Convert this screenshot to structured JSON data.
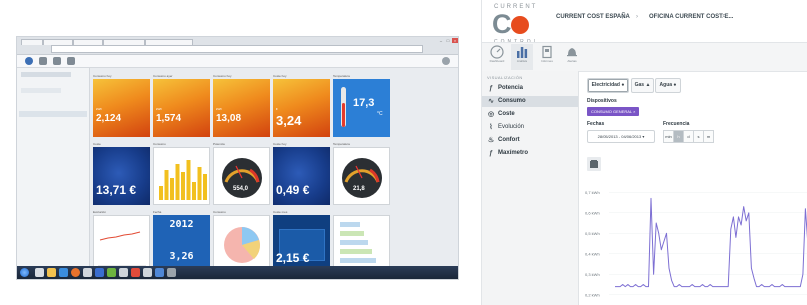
{
  "left_screenshot": {
    "browser_address": "",
    "tiles": [
      {
        "id": "t1",
        "title": "Consumo hoy",
        "value": "2,124",
        "sub": "kWh",
        "style": "orange"
      },
      {
        "id": "t2",
        "title": "Consumo ayer",
        "value": "1,574",
        "sub": "kWh",
        "style": "orange"
      },
      {
        "id": "t3",
        "title": "Consumo hoy",
        "value": "13,08",
        "sub": "kWh",
        "style": "orange"
      },
      {
        "id": "t4",
        "title": "Coste hoy",
        "value": "3,24",
        "sub": "€",
        "style": "orange"
      },
      {
        "id": "t5",
        "title": "Temperatura",
        "value": "17,3",
        "sub": "°C",
        "style": "thermo"
      },
      {
        "id": "t6",
        "title": "Coste",
        "value": "13,71 €",
        "sub": "",
        "style": "blue"
      },
      {
        "id": "t7",
        "title": "Consumo",
        "value": "",
        "sub": "",
        "style": "bars"
      },
      {
        "id": "t8",
        "title": "Potencia",
        "value": "554,0",
        "sub": "",
        "style": "gauge"
      },
      {
        "id": "t9",
        "title": "Coste hoy",
        "value": "0,49 €",
        "sub": "",
        "style": "blue"
      },
      {
        "id": "t10",
        "title": "Temperatura",
        "value": "21,8",
        "sub": "",
        "style": "gauge"
      },
      {
        "id": "t11",
        "title": "Evolución",
        "value": "",
        "sub": "",
        "style": "line"
      },
      {
        "id": "t12",
        "title": "Fecha",
        "value": "2012",
        "sub": "3,26",
        "style": "digital"
      },
      {
        "id": "t13",
        "title": "Consumo",
        "value": "",
        "sub": "",
        "style": "pie"
      },
      {
        "id": "t14",
        "title": "Coste mes",
        "value": "2,15 €",
        "sub": "",
        "style": "navy"
      },
      {
        "id": "t15",
        "title": "",
        "value": "",
        "sub": "",
        "style": "list"
      }
    ]
  },
  "app": {
    "logo": {
      "top": "CURRENT",
      "main": "COST",
      "bottom": "CONTROL"
    },
    "breadcrumb": {
      "org": "CURRENT COST ESPAÑA",
      "site": "OFICINA CURRENT COST E..."
    },
    "nav": [
      {
        "id": "dashboard",
        "label": "Dashboard",
        "icon": "gauge-icon"
      },
      {
        "id": "analisis",
        "label": "Análisis",
        "icon": "bar-chart-icon"
      },
      {
        "id": "informes",
        "label": "Informes",
        "icon": "report-icon"
      },
      {
        "id": "alertas",
        "label": "Alertas",
        "icon": "bell-icon"
      }
    ],
    "sidebar": {
      "heading": "VISUALIZACIÓN",
      "items": [
        {
          "label": "Potencia",
          "icon": "power-icon"
        },
        {
          "label": "Consumo",
          "icon": "consumption-icon"
        },
        {
          "label": "Coste",
          "icon": "cost-icon"
        },
        {
          "label": "Evolución",
          "icon": "evolution-icon"
        },
        {
          "label": "Confort",
          "icon": "comfort-icon"
        },
        {
          "label": "Maxímetro",
          "icon": "maximeter-icon"
        }
      ]
    },
    "filters": {
      "types": [
        {
          "label": "Electricidad"
        },
        {
          "label": "Gas"
        },
        {
          "label": "Agua"
        }
      ],
      "devices_label": "Dispositivos",
      "device_tag": "CONSUMO GENERAL",
      "dates_label": "Fechas",
      "date_range": "28/05/2013 - 04/06/2013",
      "frequency_label": "Frecuencia",
      "frequency": [
        "min",
        "h",
        "d",
        "s",
        "m"
      ]
    },
    "chart_data": {
      "type": "line",
      "y_ticks": [
        "0,7 kWh",
        "0,6 kWh",
        "0,5 kWh",
        "0,4 kWh",
        "0,3 kWh",
        "0,2 kWh"
      ],
      "ylim": [
        0.15,
        0.75
      ],
      "series": [
        {
          "values": [
            0.24,
            0.24,
            0.24,
            0.25,
            0.24,
            0.25,
            0.24,
            0.24,
            0.25,
            0.24,
            0.24,
            0.25,
            0.24,
            0.24,
            0.67,
            0.3,
            0.55,
            0.5,
            0.42,
            0.46,
            0.5,
            0.33,
            0.27,
            0.24,
            0.24,
            0.25,
            0.24,
            0.24,
            0.24,
            0.24,
            0.25,
            0.24,
            0.24,
            0.24,
            0.25,
            0.24,
            0.24,
            0.25,
            0.24,
            0.24,
            0.24,
            0.24,
            0.24,
            0.24,
            0.24,
            0.52,
            0.58,
            0.48,
            0.58,
            0.54,
            0.63,
            0.56,
            0.6,
            0.33,
            0.28,
            0.24,
            0.24,
            0.25,
            0.24,
            0.24,
            0.24,
            0.25,
            0.24,
            0.24,
            0.24,
            0.25,
            0.24,
            0.24,
            0.24,
            0.24,
            0.24,
            0.24,
            0.24,
            0.3,
            0.62,
            0.44
          ]
        }
      ]
    }
  }
}
